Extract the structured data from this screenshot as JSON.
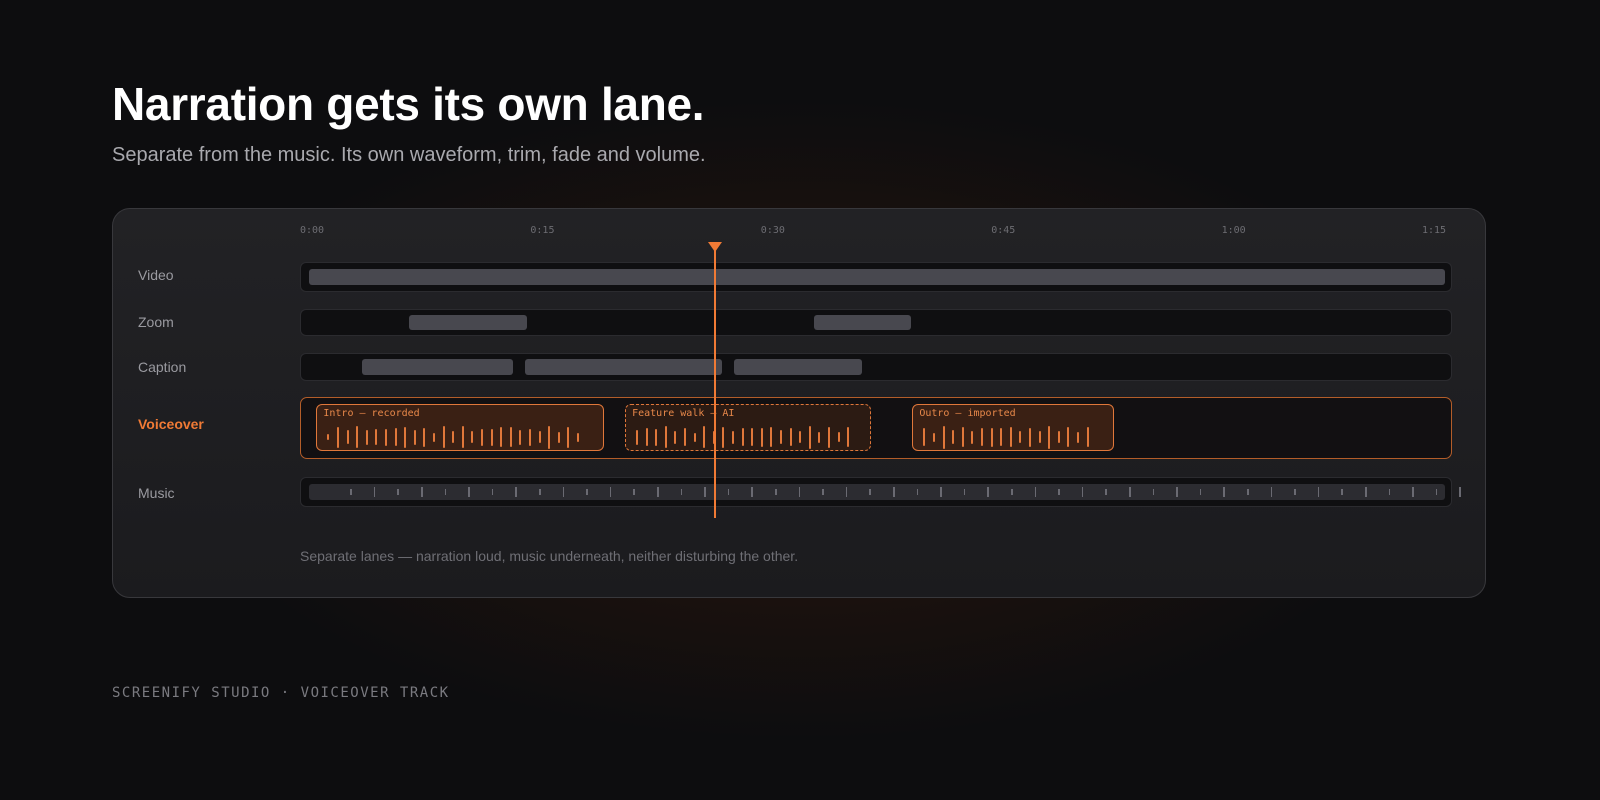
{
  "headline": "Narration gets its own lane.",
  "subheadline": "Separate from the music. Its own waveform, trim, fade and volume.",
  "timeline": {
    "duration_seconds": 75,
    "ruler_ticks": [
      "0:00",
      "0:15",
      "0:30",
      "0:45",
      "1:00",
      "1:15"
    ],
    "playhead_seconds": 27,
    "lanes": {
      "video": {
        "label": "Video",
        "clips": [
          {
            "start": 0.5,
            "end": 74.5
          }
        ]
      },
      "zoom": {
        "label": "Zoom",
        "clips": [
          {
            "start": 7,
            "end": 14.7
          },
          {
            "start": 33.4,
            "end": 39.7
          }
        ]
      },
      "caption": {
        "label": "Caption",
        "clips": [
          {
            "start": 4,
            "end": 13.8
          },
          {
            "start": 14.6,
            "end": 27.4
          },
          {
            "start": 28.2,
            "end": 36.5
          }
        ]
      },
      "voiceover": {
        "label": "Voiceover",
        "clips": [
          {
            "title": "Intro — recorded",
            "start": 1,
            "end": 19.7,
            "style": "solid"
          },
          {
            "title": "Feature walk — AI",
            "start": 21.1,
            "end": 37.1,
            "style": "dashed"
          },
          {
            "title": "Outro — imported",
            "start": 39.8,
            "end": 52.9,
            "style": "solid"
          }
        ]
      },
      "music": {
        "label": "Music",
        "clips": [
          {
            "start": 0.5,
            "end": 74.5
          }
        ]
      }
    },
    "caption": "Separate lanes — narration loud, music underneath, neither disturbing the other."
  },
  "footer": "SCREENIFY STUDIO · VOICEOVER TRACK",
  "colors": {
    "accent": "#f07a35",
    "clip_fill": "#3a2014",
    "block": "#48484f",
    "background": "#0d0d0f"
  }
}
